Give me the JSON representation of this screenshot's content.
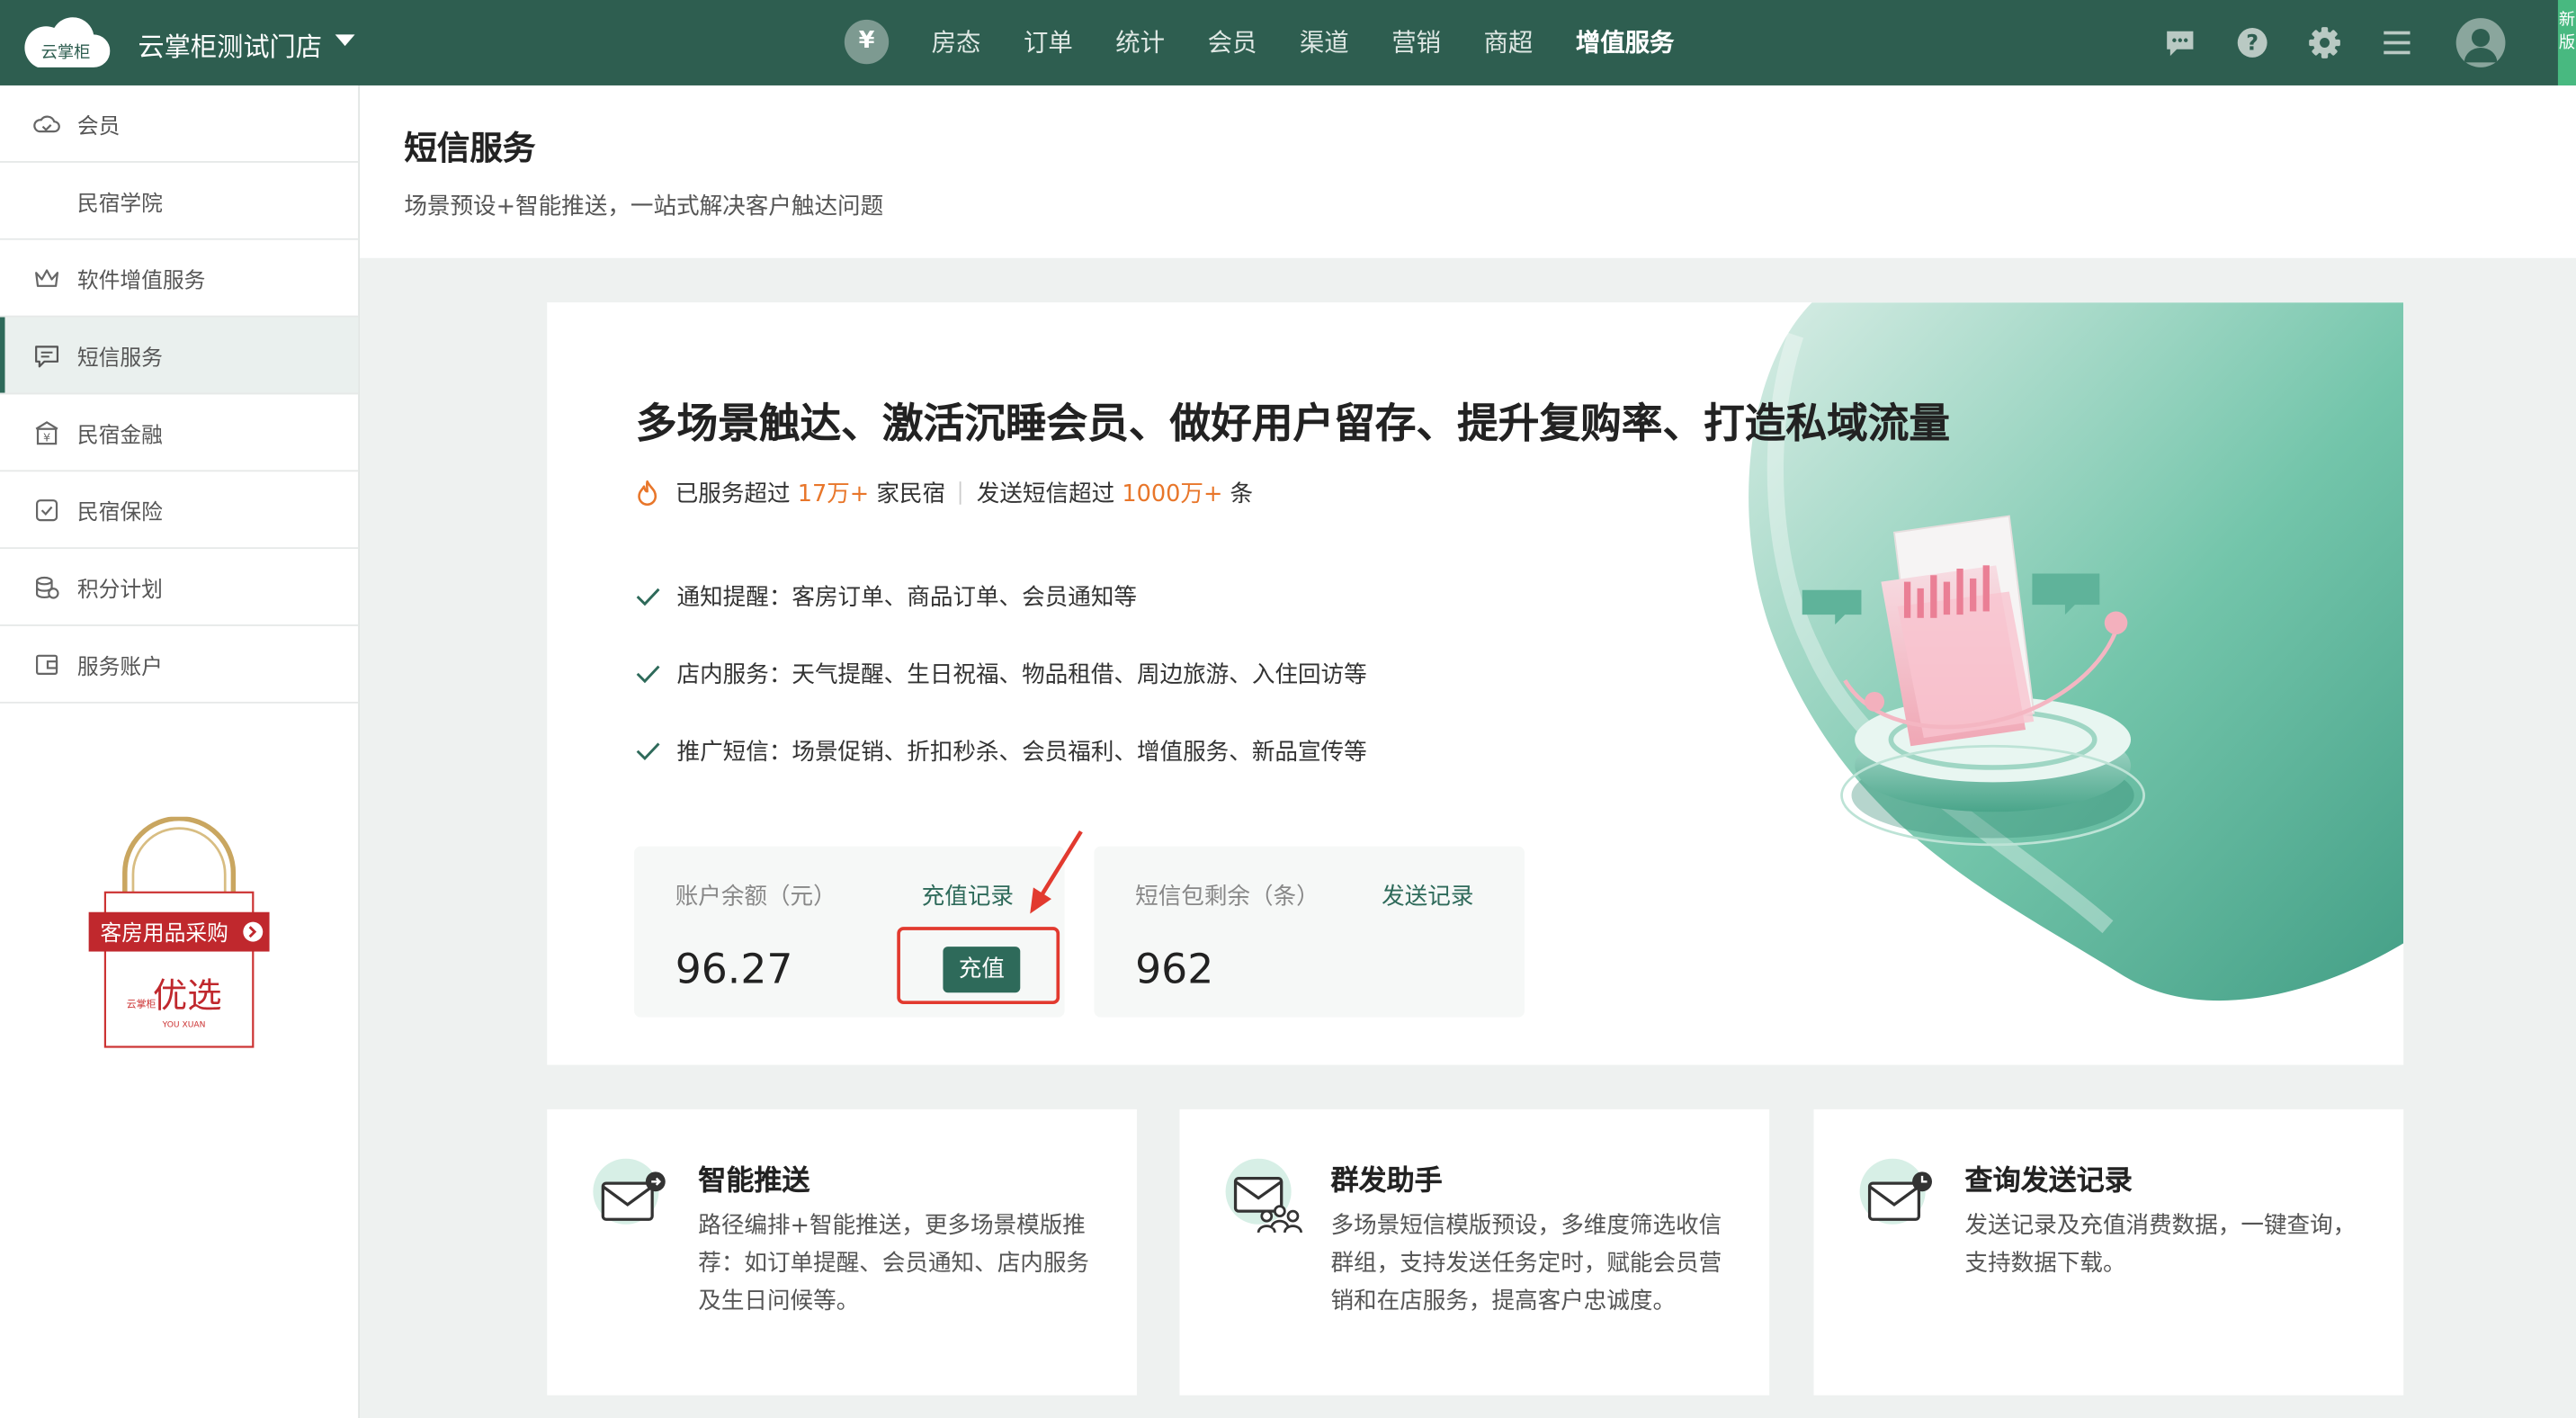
{
  "topbar": {
    "logo_text": "云掌柜",
    "store_name": "云掌柜测试门店",
    "yen_symbol": "¥",
    "nav": [
      "房态",
      "订单",
      "统计",
      "会员",
      "渠道",
      "营销",
      "商超",
      "增值服务"
    ],
    "active_nav": "增值服务",
    "new_badge": "新版",
    "colors": {
      "bar": "#2e5e50",
      "accent": "#2e6a5a"
    }
  },
  "sidebar": {
    "items": [
      {
        "label": "会员",
        "icon": "cloud-icon"
      },
      {
        "label": "民宿学院",
        "icon": ""
      },
      {
        "label": "软件增值服务",
        "icon": "crown-icon"
      },
      {
        "label": "短信服务",
        "icon": "message-icon"
      },
      {
        "label": "民宿金融",
        "icon": "bank-icon"
      },
      {
        "label": "民宿保险",
        "icon": "shield-check-icon"
      },
      {
        "label": "积分计划",
        "icon": "coins-icon"
      },
      {
        "label": "服务账户",
        "icon": "wallet-icon"
      }
    ],
    "active": "短信服务",
    "promo": {
      "label": "客房用品采购",
      "brand": "优选",
      "brand_sub": "YOU XUAN",
      "brand_prefix": "云掌柜"
    }
  },
  "header": {
    "title": "短信服务",
    "subtitle": "场景预设+智能推送，一站式解决客户触达问题"
  },
  "hero": {
    "title": "多场景触达、激活沉睡会员、做好用户留存、提升复购率、打造私域流量",
    "stats": {
      "served_prefix": "已服务超过",
      "served_value": "17万+",
      "served_suffix": "家民宿",
      "sent_prefix": "发送短信超过",
      "sent_value": "1000万+",
      "sent_suffix": "条"
    },
    "features": [
      "通知提醒：客房订单、商品订单、会员通知等",
      "店内服务：天气提醒、生日祝福、物品租借、周边旅游、入住回访等",
      "推广短信：场景促销、折扣秒杀、会员福利、增值服务、新品宣传等"
    ]
  },
  "account": {
    "balance_label": "账户余额（元）",
    "balance_link": "充值记录",
    "balance_value": "96.27",
    "recharge_button": "充值",
    "sms_label": "短信包剩余（条）",
    "sms_link": "发送记录",
    "sms_value": "962"
  },
  "cards": [
    {
      "title": "智能推送",
      "desc": "路径编排+智能推送，更多场景模版推荐：如订单提醒、会员通知、店内服务及生日问候等。",
      "icon": "mail-send-icon"
    },
    {
      "title": "群发助手",
      "desc": "多场景短信模版预设，多维度筛选收信群组，支持发送任务定时，赋能会员营销和在店服务，提高客户忠诚度。",
      "icon": "mail-group-icon"
    },
    {
      "title": "查询发送记录",
      "desc": "发送记录及充值消费数据，一键查询，支持数据下载。",
      "icon": "mail-clock-icon"
    }
  ]
}
